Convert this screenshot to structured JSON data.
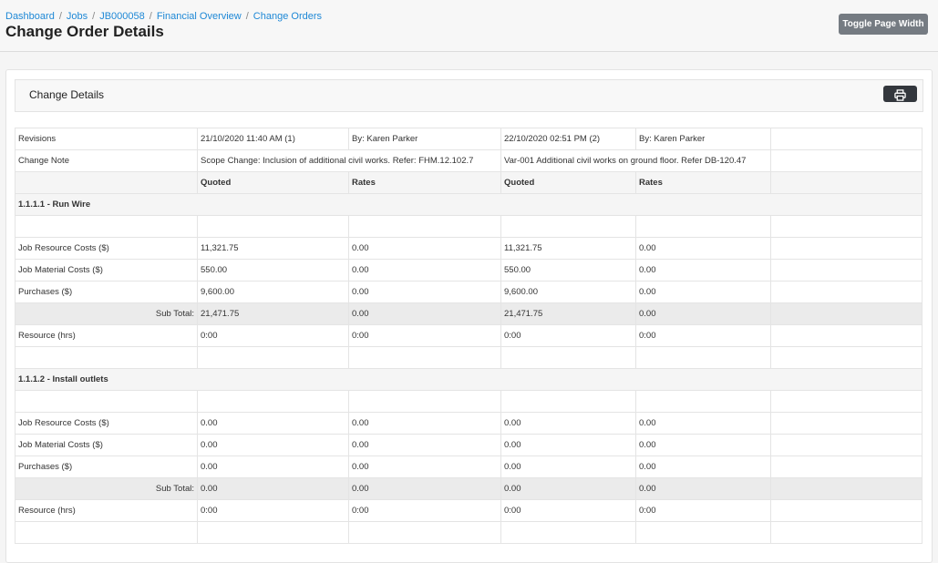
{
  "breadcrumb": [
    "Dashboard",
    "Jobs",
    "JB000058",
    "Financial Overview",
    "Change Orders"
  ],
  "page_title": "Change Order Details",
  "toggle_label": "Toggle Page Width",
  "card_title": "Change Details",
  "print_icon": "print-icon",
  "table": {
    "revisions": {
      "label": "Revisions",
      "rev1_date": "21/10/2020 11:40 AM (1)",
      "rev1_by": "By: Karen Parker",
      "rev2_date": "22/10/2020 02:51 PM (2)",
      "rev2_by": "By: Karen Parker"
    },
    "change_note": {
      "label": "Change Note",
      "rev1": "Scope Change: Inclusion of additional civil works. Refer: FHM.12.102.7",
      "rev2": "Var-001 Additional civil works on ground floor. Refer DB-120.47"
    },
    "columns": {
      "quoted1": "Quoted",
      "rates1": "Rates",
      "quoted2": "Quoted",
      "rates2": "Rates"
    },
    "sections": [
      {
        "title": "1.1.1.1 - Run Wire",
        "rows": [
          {
            "label": "Job Resource Costs ($)",
            "q1": "11,321.75",
            "r1": "0.00",
            "q2": "11,321.75",
            "r2": "0.00"
          },
          {
            "label": "Job Material Costs ($)",
            "q1": "550.00",
            "r1": "0.00",
            "q2": "550.00",
            "r2": "0.00"
          },
          {
            "label": "Purchases ($)",
            "q1": "9,600.00",
            "r1": "0.00",
            "q2": "9,600.00",
            "r2": "0.00"
          }
        ],
        "subtotal": {
          "label": "Sub Total:",
          "q1": "21,471.75",
          "r1": "0.00",
          "q2": "21,471.75",
          "r2": "0.00"
        },
        "resource": {
          "label": "Resource (hrs)",
          "q1": "0:00",
          "r1": "0:00",
          "q2": "0:00",
          "r2": "0:00"
        }
      },
      {
        "title": "1.1.1.2 - Install outlets",
        "rows": [
          {
            "label": "Job Resource Costs ($)",
            "q1": "0.00",
            "r1": "0.00",
            "q2": "0.00",
            "r2": "0.00"
          },
          {
            "label": "Job Material Costs ($)",
            "q1": "0.00",
            "r1": "0.00",
            "q2": "0.00",
            "r2": "0.00"
          },
          {
            "label": "Purchases ($)",
            "q1": "0.00",
            "r1": "0.00",
            "q2": "0.00",
            "r2": "0.00"
          }
        ],
        "subtotal": {
          "label": "Sub Total:",
          "q1": "0.00",
          "r1": "0.00",
          "q2": "0.00",
          "r2": "0.00"
        },
        "resource": {
          "label": "Resource (hrs)",
          "q1": "0:00",
          "r1": "0:00",
          "q2": "0:00",
          "r2": "0:00"
        }
      }
    ]
  }
}
